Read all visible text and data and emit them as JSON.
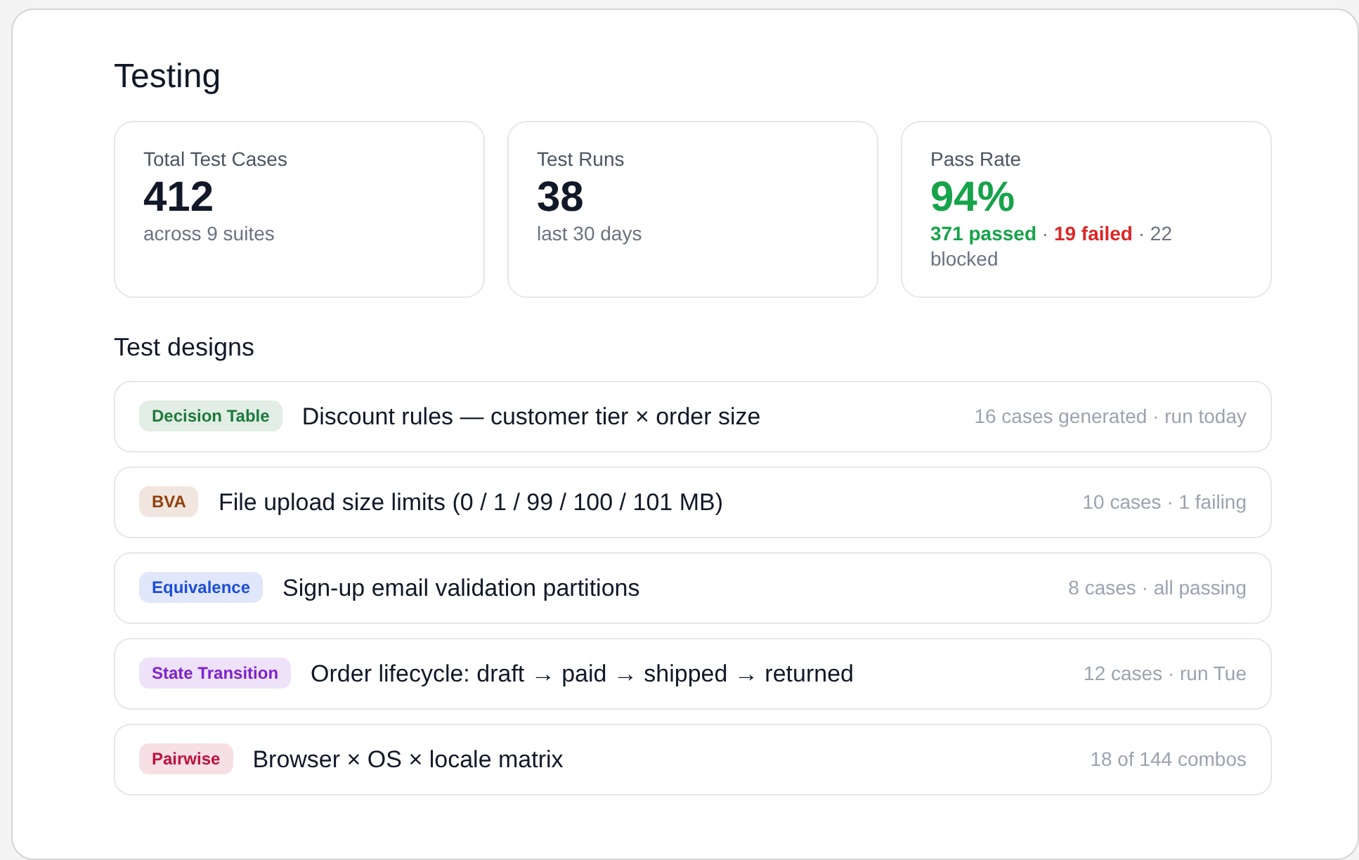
{
  "title": "Testing",
  "stats": [
    {
      "label": "Total Test Cases",
      "value": "412",
      "kind": "neutral",
      "sub": [
        {
          "text": "across 9 suites",
          "kind": "muted"
        }
      ]
    },
    {
      "label": "Test Runs",
      "value": "38",
      "kind": "neutral",
      "sub": [
        {
          "text": "last 30 days",
          "kind": "muted"
        }
      ]
    },
    {
      "label": "Pass Rate",
      "value": "94%",
      "kind": "success",
      "sub": [
        {
          "text": "371 passed",
          "kind": "success"
        },
        {
          "text": " · ",
          "kind": "muted"
        },
        {
          "text": "19 failed",
          "kind": "danger"
        },
        {
          "text": " · 22 blocked",
          "kind": "muted"
        }
      ]
    }
  ],
  "section_title": "Test designs",
  "designs": [
    {
      "tag": "Decision Table",
      "color": "#1e7a3c",
      "name": "Discount rules — customer tier × order size",
      "meta": "16 cases generated · run today"
    },
    {
      "tag": "BVA",
      "color": "#92400e",
      "name": "File upload size limits (0 / 1 / 99 / 100 / 101 MB)",
      "meta": "10 cases · 1 failing"
    },
    {
      "tag": "Equivalence",
      "color": "#1d4ed8",
      "name": "Sign-up email validation partitions",
      "meta": "8 cases · all passing"
    },
    {
      "tag": "State Transition",
      "color": "#7e22ce",
      "name": "Order lifecycle: draft → paid → shipped → returned",
      "meta": "12 cases · run Tue"
    },
    {
      "tag": "Pairwise",
      "color": "#be123c",
      "name": "Browser × OS × locale matrix",
      "meta": "18 of 144 combos"
    }
  ]
}
